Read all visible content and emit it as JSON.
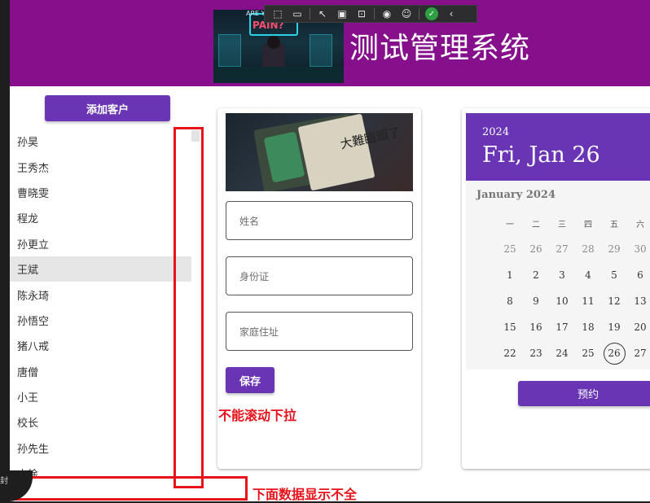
{
  "header": {
    "title": "测试管理系统",
    "image_sign_text": "PAIN?",
    "image_sign_top": "ARE YOU"
  },
  "toolbar": {
    "buttons": [
      "select-element-icon",
      "camera-icon",
      "pointer-icon",
      "frame-icon",
      "tracking-icon",
      "hot-reload-icon",
      "accessibility-icon",
      "status-ok-icon",
      "collapse-icon"
    ]
  },
  "sidebar": {
    "add_button": "添加客户",
    "selected_index": 5,
    "customers": [
      "孙昊",
      "王秀杰",
      "曹晓雯",
      "程龙",
      "孙更立",
      "王斌",
      "陈永琦",
      "孙悟空",
      "猪八戒",
      "唐僧",
      "小王",
      "校长",
      "孙先生",
      "小徐"
    ]
  },
  "form": {
    "name_placeholder": "姓名",
    "id_placeholder": "身份证",
    "address_placeholder": "家庭住址",
    "save_button": "保存",
    "image_ink": "大難臨頭了"
  },
  "calendar": {
    "year": "2024",
    "date": "Fri, Jan 26",
    "month_label": "January 2024",
    "weekdays": [
      "一",
      "二",
      "三",
      "四",
      "五",
      "六"
    ],
    "weeks": [
      [
        "25",
        "26",
        "27",
        "28",
        "29",
        "30"
      ],
      [
        "1",
        "2",
        "3",
        "4",
        "5",
        "6"
      ],
      [
        "8",
        "9",
        "10",
        "11",
        "12",
        "13"
      ],
      [
        "15",
        "16",
        "17",
        "18",
        "19",
        "20"
      ],
      [
        "22",
        "23",
        "24",
        "25",
        "26",
        "27"
      ]
    ],
    "selected_day": "26",
    "book_button": "预约"
  },
  "annotations": {
    "scroll_note": "不能滚动下拉",
    "bottom_note": "下面数据显示不全"
  },
  "colors": {
    "header_bg": "#860f8c",
    "accent": "#6a35b5",
    "annotation": "#e8121b"
  },
  "bottom_corner_label": "封"
}
